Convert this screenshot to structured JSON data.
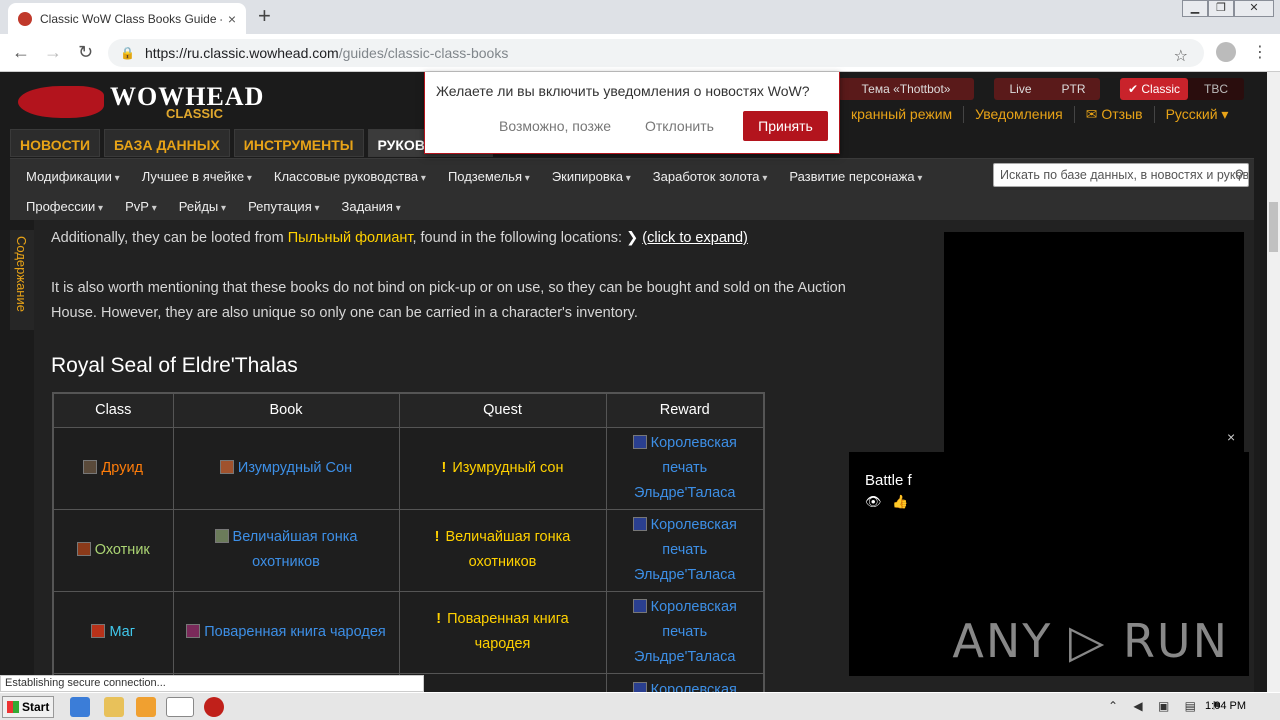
{
  "browser": {
    "tab_title": "Classic WoW Class Books Guide - Gu",
    "tab_close": "×",
    "new_tab": "+",
    "url_domain": "https://ru.classic.wowhead.com",
    "url_path": "/guides/classic-class-books",
    "status": "Establishing secure connection..."
  },
  "header": {
    "logo_word": "WOWHEAD",
    "logo_sub": "CLASSIC",
    "theme": "Тема «Thottbot»",
    "live": "Live",
    "ptr": "PTR",
    "classic": "✔ Classic",
    "tbc": "TBC",
    "toplinks": [
      "кранный режим",
      "Уведомления",
      "✉ Отзыв",
      "Русский ▾"
    ],
    "main_tabs": [
      "НОВОСТИ",
      "БАЗА ДАННЫХ",
      "ИНСТРУМЕНТЫ",
      "РУКОВОДСТВА"
    ],
    "subnav_row1": [
      "Модификации",
      "Лучшее в ячейке",
      "Классовые руководства",
      "Подземелья",
      "Экипировка",
      "Заработок золота",
      "Развитие персонажа"
    ],
    "subnav_row2": [
      "Профессии",
      "PvP",
      "Рейды",
      "Репутация",
      "Задания"
    ],
    "search_placeholder": "Искать по базе данных, в новостях и руководствах"
  },
  "notification": {
    "question": "Желаете ли вы включить уведомления о новостях WoW?",
    "later": "Возможно, позже",
    "decline": "Отклонить",
    "accept": "Принять"
  },
  "content": {
    "toc": "Содержание",
    "p1_before": "Additionally, they can be looted from ",
    "p1_link": "Пыльный фолиант",
    "p1_after": ", found in the following locations: ",
    "p1_expand": "(click to expand)",
    "p2": "It is also worth mentioning that these books do not bind on pick-up or on use, so they can be bought and sold on the Auction House. However, they are also unique so only one can be carried in a character's inventory.",
    "heading": "Royal Seal of Eldre'Thalas",
    "table": {
      "headers": [
        "Class",
        "Book",
        "Quest",
        "Reward"
      ],
      "rows": [
        {
          "class": "Друид",
          "book": "Изумрудный Сон",
          "quest": "Изумрудный сон",
          "reward": "Королевская печать Эльдре'Таласа"
        },
        {
          "class": "Охотник",
          "book": "Величайшая гонка охотников",
          "quest": "Величайшая гонка охотников",
          "reward": "Королевская печать Эльдре'Таласа"
        },
        {
          "class": "Маг",
          "book": "Поваренная книга чародея",
          "quest": "Поваренная книга чародея",
          "reward": "Королевская печать Эльдре'Таласа"
        },
        {
          "class": "",
          "book": "",
          "quest": "",
          "reward": "Королевская"
        }
      ]
    }
  },
  "video": {
    "title": "Battle f",
    "watermark": "ANY ▷ RUN",
    "close": "×"
  },
  "taskbar": {
    "start": "Start",
    "clock": "1:04 PM"
  },
  "colors": {
    "accent_red": "#b3141d",
    "gold": "#ffd100",
    "link_blue": "#3d8fe6"
  }
}
